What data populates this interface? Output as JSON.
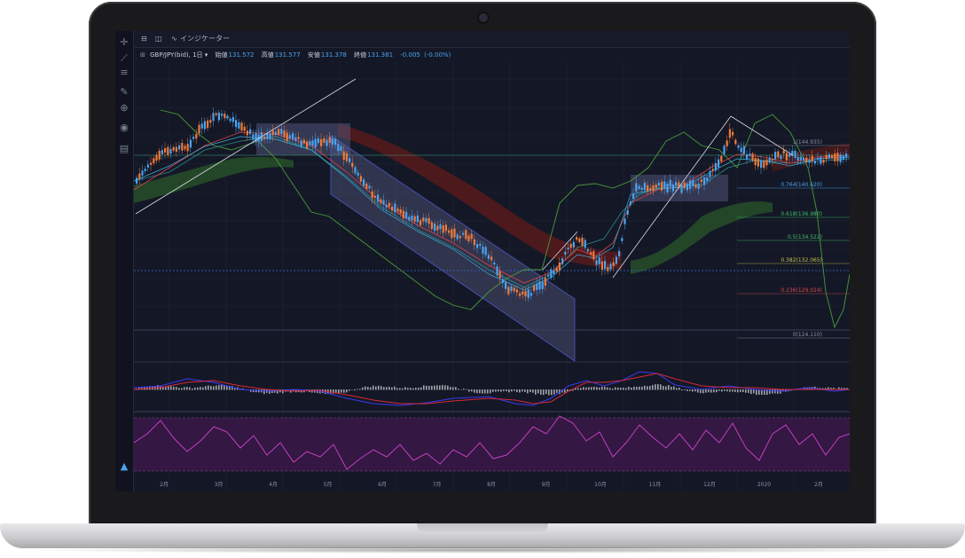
{
  "toolbar": {
    "layout_icon": "layout-icon",
    "compare_icon": "compare-icon",
    "indicator_label": "インジケーター"
  },
  "symbol": {
    "name": "GBP/JPY(bid)",
    "timeframe": "1日",
    "open_label": "始値",
    "open_value": "131.572",
    "high_label": "高値",
    "high_value": "131.577",
    "low_label": "安値",
    "low_value": "131.378",
    "close_label": "終値",
    "close_value": "131.381",
    "change": "-0.005",
    "change_pct": "(-0.00%)"
  },
  "left_tools": [
    "crosshair-icon",
    "trendline-icon",
    "fib-icon",
    "brush-icon",
    "zoom-icon",
    "eye-icon",
    "trash-icon"
  ],
  "fib_levels": [
    {
      "ratio": "1",
      "price": "(144.935)",
      "color": "#8a90a6"
    },
    {
      "ratio": "0.764",
      "price": "(140.620)",
      "color": "#4aa3f0"
    },
    {
      "ratio": "0.618",
      "price": "(136.980)",
      "color": "#3fbf6a"
    },
    {
      "ratio": "0.5",
      "price": "(134.522)",
      "color": "#3fbf6a"
    },
    {
      "ratio": "0.382",
      "price": "(132.065)",
      "color": "#c8c24a"
    },
    {
      "ratio": "0.236",
      "price": "(129.024)",
      "color": "#d84a4a"
    },
    {
      "ratio": "0",
      "price": "(124.110)",
      "color": "#8a90a6"
    }
  ],
  "months": [
    "2月",
    "3月",
    "4月",
    "5月",
    "6月",
    "7月",
    "8月",
    "9月",
    "10月",
    "11月",
    "12月",
    "2020",
    "2月"
  ],
  "colors": {
    "up": "#4aa3f0",
    "down": "#f07a3a",
    "cloud_green": "#2e6b2e",
    "cloud_red": "#6b1e1e",
    "macd": "#3a3af0",
    "signal": "#d8283a",
    "rsi_band": "#3a1a4a",
    "rsi_line": "#c040c0"
  }
}
